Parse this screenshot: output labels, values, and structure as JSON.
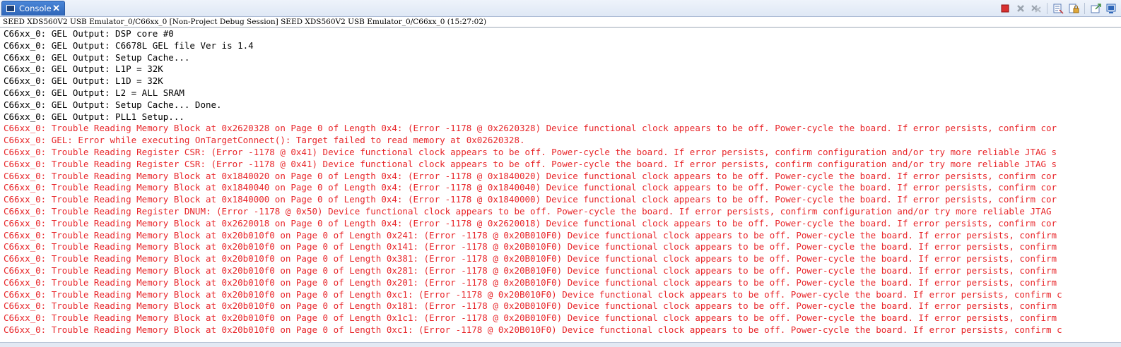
{
  "tab": {
    "label": "Console",
    "close": "✕"
  },
  "toolbar": {
    "buttons": [
      {
        "name": "terminate-icon",
        "color": "#d83030"
      },
      {
        "name": "remove-launch-icon",
        "color": "#9aa3ae"
      },
      {
        "name": "remove-all-icon",
        "color": "#9aa3ae"
      },
      {
        "name": "clear-console-icon",
        "color": "#5a7bb5"
      },
      {
        "name": "scroll-lock-icon",
        "color": "#c08b2a"
      },
      {
        "name": "pin-console-icon",
        "color": "#3b8a3b"
      },
      {
        "name": "display-console-icon",
        "color": "#2f66b8"
      }
    ]
  },
  "header": {
    "text": "SEED XDS560V2 USB Emulator_0/C66xx_0 [Non-Project Debug Session] SEED XDS560V2 USB Emulator_0/C66xx_0 (15:27:02)"
  },
  "colors": {
    "normal": "#000000",
    "error": "#e8262a"
  },
  "lines": [
    {
      "text": "C66xx_0: GEL Output: DSP core #0",
      "type": "normal"
    },
    {
      "text": "C66xx_0: GEL Output: C6678L GEL file Ver is 1.4",
      "type": "normal"
    },
    {
      "text": "C66xx_0: GEL Output: Setup Cache...",
      "type": "normal"
    },
    {
      "text": "C66xx_0: GEL Output: L1P = 32K",
      "type": "normal"
    },
    {
      "text": "C66xx_0: GEL Output: L1D = 32K",
      "type": "normal"
    },
    {
      "text": "C66xx_0: GEL Output: L2 = ALL SRAM",
      "type": "normal"
    },
    {
      "text": "C66xx_0: GEL Output: Setup Cache... Done.",
      "type": "normal"
    },
    {
      "text": "C66xx_0: GEL Output: PLL1 Setup...",
      "type": "normal"
    },
    {
      "text": "C66xx_0: Trouble Reading Memory Block at 0x2620328 on Page 0 of Length 0x4: (Error -1178 @ 0x2620328) Device functional clock appears to be off. Power-cycle the board. If error persists, confirm cor",
      "type": "error"
    },
    {
      "text": "C66xx_0: GEL: Error while executing OnTargetConnect(): Target failed to read memory at 0x02620328.",
      "type": "error"
    },
    {
      "text": "C66xx_0: Trouble Reading Register CSR: (Error -1178 @ 0x41) Device functional clock appears to be off. Power-cycle the board. If error persists, confirm configuration and/or try more reliable JTAG s",
      "type": "error"
    },
    {
      "text": "C66xx_0: Trouble Reading Register CSR: (Error -1178 @ 0x41) Device functional clock appears to be off. Power-cycle the board. If error persists, confirm configuration and/or try more reliable JTAG s",
      "type": "error"
    },
    {
      "text": "C66xx_0: Trouble Reading Memory Block at 0x1840020 on Page 0 of Length 0x4: (Error -1178 @ 0x1840020) Device functional clock appears to be off. Power-cycle the board. If error persists, confirm cor",
      "type": "error"
    },
    {
      "text": "C66xx_0: Trouble Reading Memory Block at 0x1840040 on Page 0 of Length 0x4: (Error -1178 @ 0x1840040) Device functional clock appears to be off. Power-cycle the board. If error persists, confirm cor",
      "type": "error"
    },
    {
      "text": "C66xx_0: Trouble Reading Memory Block at 0x1840000 on Page 0 of Length 0x4: (Error -1178 @ 0x1840000) Device functional clock appears to be off. Power-cycle the board. If error persists, confirm cor",
      "type": "error"
    },
    {
      "text": "C66xx_0: Trouble Reading Register DNUM: (Error -1178 @ 0x50) Device functional clock appears to be off. Power-cycle the board. If error persists, confirm configuration and/or try more reliable JTAG",
      "type": "error"
    },
    {
      "text": "C66xx_0: Trouble Reading Memory Block at 0x2620018 on Page 0 of Length 0x4: (Error -1178 @ 0x2620018) Device functional clock appears to be off. Power-cycle the board. If error persists, confirm cor",
      "type": "error"
    },
    {
      "text": "C66xx_0: Trouble Reading Memory Block at 0x20b010f0 on Page 0 of Length 0x241: (Error -1178 @ 0x20B010F0) Device functional clock appears to be off. Power-cycle the board. If error persists, confirm",
      "type": "error"
    },
    {
      "text": "C66xx_0: Trouble Reading Memory Block at 0x20b010f0 on Page 0 of Length 0x141: (Error -1178 @ 0x20B010F0) Device functional clock appears to be off. Power-cycle the board. If error persists, confirm",
      "type": "error"
    },
    {
      "text": "C66xx_0: Trouble Reading Memory Block at 0x20b010f0 on Page 0 of Length 0x381: (Error -1178 @ 0x20B010F0) Device functional clock appears to be off. Power-cycle the board. If error persists, confirm",
      "type": "error"
    },
    {
      "text": "C66xx_0: Trouble Reading Memory Block at 0x20b010f0 on Page 0 of Length 0x281: (Error -1178 @ 0x20B010F0) Device functional clock appears to be off. Power-cycle the board. If error persists, confirm",
      "type": "error"
    },
    {
      "text": "C66xx_0: Trouble Reading Memory Block at 0x20b010f0 on Page 0 of Length 0x201: (Error -1178 @ 0x20B010F0) Device functional clock appears to be off. Power-cycle the board. If error persists, confirm",
      "type": "error"
    },
    {
      "text": "C66xx_0: Trouble Reading Memory Block at 0x20b010f0 on Page 0 of Length 0xc1: (Error -1178 @ 0x20B010F0) Device functional clock appears to be off. Power-cycle the board. If error persists, confirm c",
      "type": "error"
    },
    {
      "text": "C66xx_0: Trouble Reading Memory Block at 0x20b010f0 on Page 0 of Length 0x181: (Error -1178 @ 0x20B010F0) Device functional clock appears to be off. Power-cycle the board. If error persists, confirm",
      "type": "error"
    },
    {
      "text": "C66xx_0: Trouble Reading Memory Block at 0x20b010f0 on Page 0 of Length 0x1c1: (Error -1178 @ 0x20B010F0) Device functional clock appears to be off. Power-cycle the board. If error persists, confirm",
      "type": "error"
    },
    {
      "text": "C66xx_0: Trouble Reading Memory Block at 0x20b010f0 on Page 0 of Length 0xc1: (Error -1178 @ 0x20B010F0) Device functional clock appears to be off. Power-cycle the board. If error persists, confirm c",
      "type": "error"
    }
  ]
}
